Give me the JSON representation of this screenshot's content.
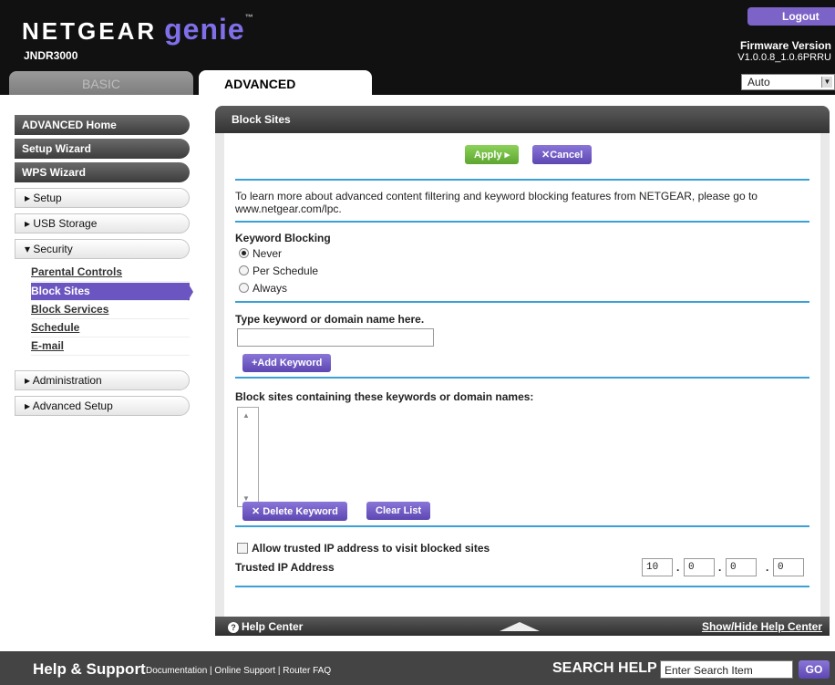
{
  "header": {
    "brand": "NETGEAR",
    "product": "genie",
    "tm": "™",
    "model": "JNDR3000",
    "logout_label": "Logout",
    "firmware_label": "Firmware Version",
    "firmware_value": "V1.0.0.8_1.0.6PRRU",
    "language_selected": "Auto",
    "tabs": {
      "basic": "BASIC",
      "advanced": "ADVANCED"
    }
  },
  "sidebar": {
    "advanced_home": "ADVANCED Home",
    "setup_wizard": "Setup Wizard",
    "wps_wizard": "WPS Wizard",
    "setup": "▸ Setup",
    "usb_storage": "▸ USB Storage",
    "security": "▾ Security",
    "security_items": [
      "Parental Controls",
      "Block Sites",
      "Block Services",
      "Schedule",
      "E-mail"
    ],
    "administration": "▸ Administration",
    "advanced_setup": "▸ Advanced Setup"
  },
  "main": {
    "title": "Block Sites",
    "apply_label": "Apply ▸",
    "cancel_label": "✕Cancel",
    "info_line1": "To learn more about advanced content filtering and keyword blocking features from NETGEAR, please go to",
    "info_line2": "www.netgear.com/lpc.",
    "keyword_blocking_label": "Keyword Blocking",
    "options": [
      "Never",
      "Per Schedule",
      "Always"
    ],
    "selected_option": "Never",
    "type_keyword_label": "Type keyword or domain name here.",
    "keyword_value": "",
    "add_keyword_label": "+Add Keyword",
    "block_list_label": "Block sites containing these keywords or domain names:",
    "delete_keyword_label": "✕ Delete Keyword",
    "clear_list_label": "Clear List",
    "allow_trusted_label": "Allow trusted IP address to visit blocked sites",
    "trusted_ip_label": "Trusted IP Address",
    "trusted_ip": [
      "10",
      "0",
      "0",
      "0"
    ],
    "ip_separator": "."
  },
  "helpbar": {
    "help_center": "Help Center",
    "toggle": "Show/Hide Help Center"
  },
  "footer": {
    "help_support": "Help & Support",
    "links": [
      "Documentation",
      "Online Support",
      "Router FAQ"
    ],
    "link_separator": " | ",
    "search_help": "SEARCH HELP",
    "search_value": "Enter Search Item",
    "go": "GO"
  }
}
